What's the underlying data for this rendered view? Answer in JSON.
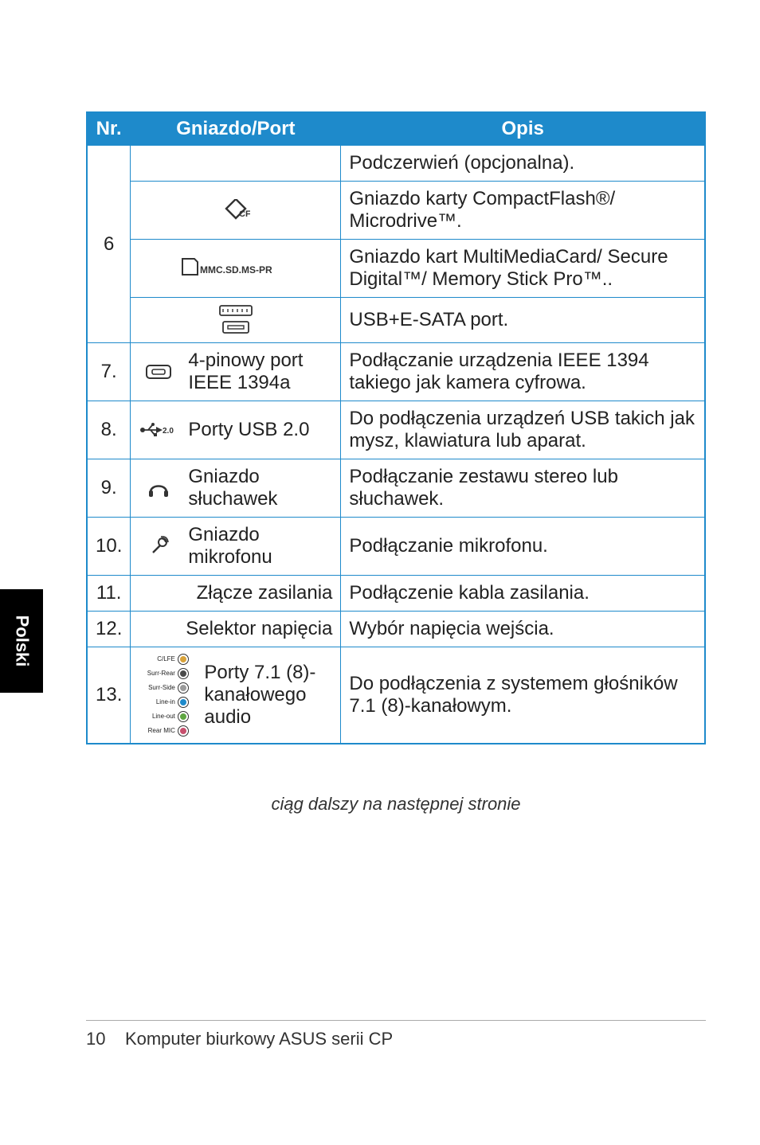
{
  "language_tab": "Polski",
  "table": {
    "headers": {
      "nr": "Nr.",
      "port": "Gniazdo/Port",
      "desc": "Opis"
    },
    "r6": {
      "nr": "6",
      "ir_desc": "Podczerwień (opcjonalna).",
      "cf_icon_sub": "CF",
      "cf_desc": "Gniazdo karty CompactFlash®/ Microdrive™.",
      "mmc_icon_sub": "MMC.SD.MS-PR",
      "mmc_desc": "Gniazdo kart MultiMediaCard/ Secure Digital™/ Memory Stick Pro™..",
      "esata_desc": "USB+E-SATA port."
    },
    "r7": {
      "nr": "7.",
      "label": "4-pinowy port IEEE 1394a",
      "desc": "Podłączanie urządzenia IEEE 1394 takiego jak kamera cyfrowa."
    },
    "r8": {
      "nr": "8.",
      "icon_sub": "2.0",
      "label": "Porty USB 2.0",
      "desc": "Do podłączenia urządzeń USB takich jak mysz, klawiatura lub aparat."
    },
    "r9": {
      "nr": "9.",
      "label": "Gniazdo słuchawek",
      "desc": "Podłączanie zestawu stereo lub słuchawek."
    },
    "r10": {
      "nr": "10.",
      "label": "Gniazdo mikrofonu",
      "desc": "Podłączanie mikrofonu."
    },
    "r11": {
      "nr": "11.",
      "label": "Złącze zasilania",
      "desc": "Podłączenie kabla zasilania."
    },
    "r12": {
      "nr": "12.",
      "label": "Selektor napięcia",
      "desc": "Wybór napięcia wejścia."
    },
    "r13": {
      "nr": "13.",
      "label": "Porty 7.1 (8)-kanałowego audio",
      "desc": "Do podłączenia z systemem głośników 7.1 (8)-kanałowym.",
      "audio_ports": [
        {
          "name": "C/LFE",
          "color": "#d8a23a"
        },
        {
          "name": "Surr-Rear",
          "color": "#4a4a4a"
        },
        {
          "name": "Surr-Side",
          "color": "#9a9a9a"
        },
        {
          "name": "Line-in",
          "color": "#1e8acb"
        },
        {
          "name": "Line-out",
          "color": "#5fa641"
        },
        {
          "name": "Rear MIC",
          "color": "#c8506e"
        }
      ]
    }
  },
  "footnote": "ciąg dalszy na następnej stronie",
  "footer": {
    "page": "10",
    "title": "Komputer biurkowy ASUS serii CP"
  }
}
